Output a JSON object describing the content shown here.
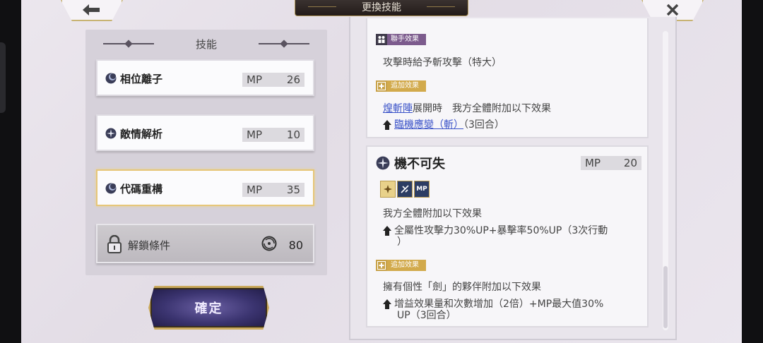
{
  "window": {
    "title": "更換技能"
  },
  "nav": {
    "back_icon": "back-arrow-icon",
    "close_icon": "close-x-icon"
  },
  "left_panel": {
    "header": "技能",
    "skills": [
      {
        "name": "相位離子",
        "mp_label": "MP",
        "mp": "26",
        "icon": "moon-orb-icon",
        "selected": false
      },
      {
        "name": "敵情解析",
        "mp_label": "MP",
        "mp": "10",
        "icon": "compass-star-icon",
        "selected": false
      },
      {
        "name": "代碼重構",
        "mp_label": "MP",
        "mp": "35",
        "icon": "moon-orb-icon",
        "selected": true
      }
    ],
    "unlock": {
      "label": "解鎖條件",
      "value": "80",
      "icon": "spiral-icon",
      "lock_icon": "lock-icon"
    },
    "confirm_label": "確定"
  },
  "detail_top": {
    "assist_tag": "聯手效果",
    "assist_text": "攻擊時給予斬攻擊（特大）",
    "extra_tag": "追加效果",
    "line1_link": "煌斬陣",
    "line1_rest": "展開時　我方全體附加以下效果",
    "line2_link": "臨機應變（斬）",
    "line2_rest": "（3回合）"
  },
  "detail_skill": {
    "name": "機不可失",
    "mp_label": "MP",
    "mp": "20",
    "icons": [
      "gold-star-icon",
      "blade-icon",
      "mp-up-icon"
    ],
    "mp_icon_text": "MP",
    "effect_header": "我方全體附加以下效果",
    "effect_line_a": "全屬性攻擊力30%UP+暴擊率50%UP（3次行動",
    "effect_line_b": "）",
    "extra_tag": "追加效果",
    "extra_header": "擁有個性「劍」的夥伴附加以下效果",
    "extra_line_a": "增益效果量和次數增加（2倍）+MP最大值30%",
    "extra_line_b": "UP（3回合）"
  },
  "colors": {
    "accent_gold": "#d2aa4c",
    "link_blue": "#3a52c8",
    "assist_purple": "#7c5b8d",
    "confirm_navy": "#3b3470"
  }
}
